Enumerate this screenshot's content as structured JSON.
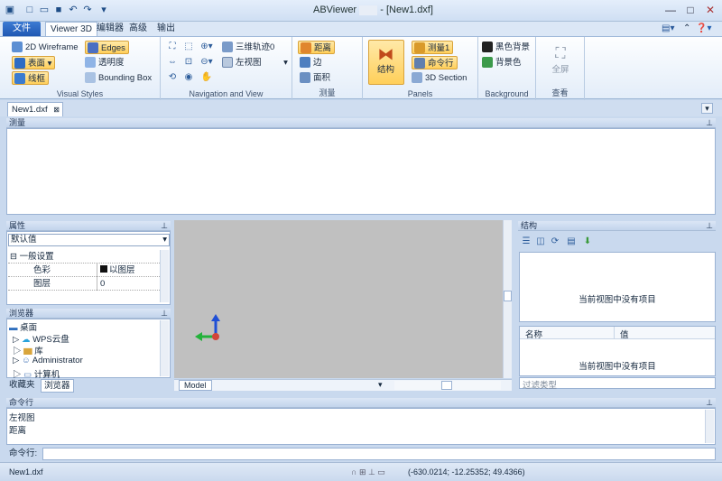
{
  "window": {
    "title": "ABViewer",
    "title_doc": "- [New1.dxf]"
  },
  "menu": {
    "file": "文件",
    "tabs": [
      "Viewer 3D",
      "编辑器",
      "高级",
      "输出"
    ]
  },
  "ribbon": {
    "visual_styles": {
      "label": "Visual Styles",
      "wireframe": "2D Wireframe",
      "surface": "表面",
      "lines": "线框",
      "edges": "Edges",
      "transparency": "透明度",
      "bbox": "Bounding Box"
    },
    "navigation": {
      "label": "Navigation and View",
      "orbit": "三维轨迹0",
      "left_view": "左视图"
    },
    "measure": {
      "label": "测量",
      "distance": "距离",
      "edge": "边",
      "area": "面积"
    },
    "panels": {
      "label": "Panels",
      "structure": "结构",
      "measure1": "测量1",
      "cmdline": "命令行",
      "section": "3D Section"
    },
    "background": {
      "label": "Background",
      "black": "黑色背景",
      "color": "背景色"
    },
    "view": {
      "label": "查看",
      "fullscreen": "全屏"
    }
  },
  "doc_tab": "New1.dxf",
  "measure_panel": {
    "title": "测量"
  },
  "properties": {
    "title": "属性",
    "dropdown": "默认值",
    "section": "一般设置",
    "rows": [
      {
        "k": "色彩",
        "v": "以图层"
      },
      {
        "k": "图层",
        "v": "0"
      }
    ]
  },
  "browser": {
    "title": "浏览器",
    "items": [
      "桌面",
      "WPS云盘",
      "库",
      "Administrator",
      "计算机"
    ],
    "tabs": [
      "收藏夹",
      "浏览器"
    ]
  },
  "viewport": {
    "tab": "Model"
  },
  "structure": {
    "title": "结构",
    "empty": "当前视图中没有项目",
    "col_name": "名称",
    "col_value": "值",
    "filter": "过滤类型"
  },
  "cmd": {
    "title": "命令行",
    "lines": [
      "左视图",
      "距离"
    ],
    "prompt": "命令行:"
  },
  "status": {
    "file": "New1.dxf",
    "coords": "(-630.0214; -12.25352; 49.4366)"
  }
}
